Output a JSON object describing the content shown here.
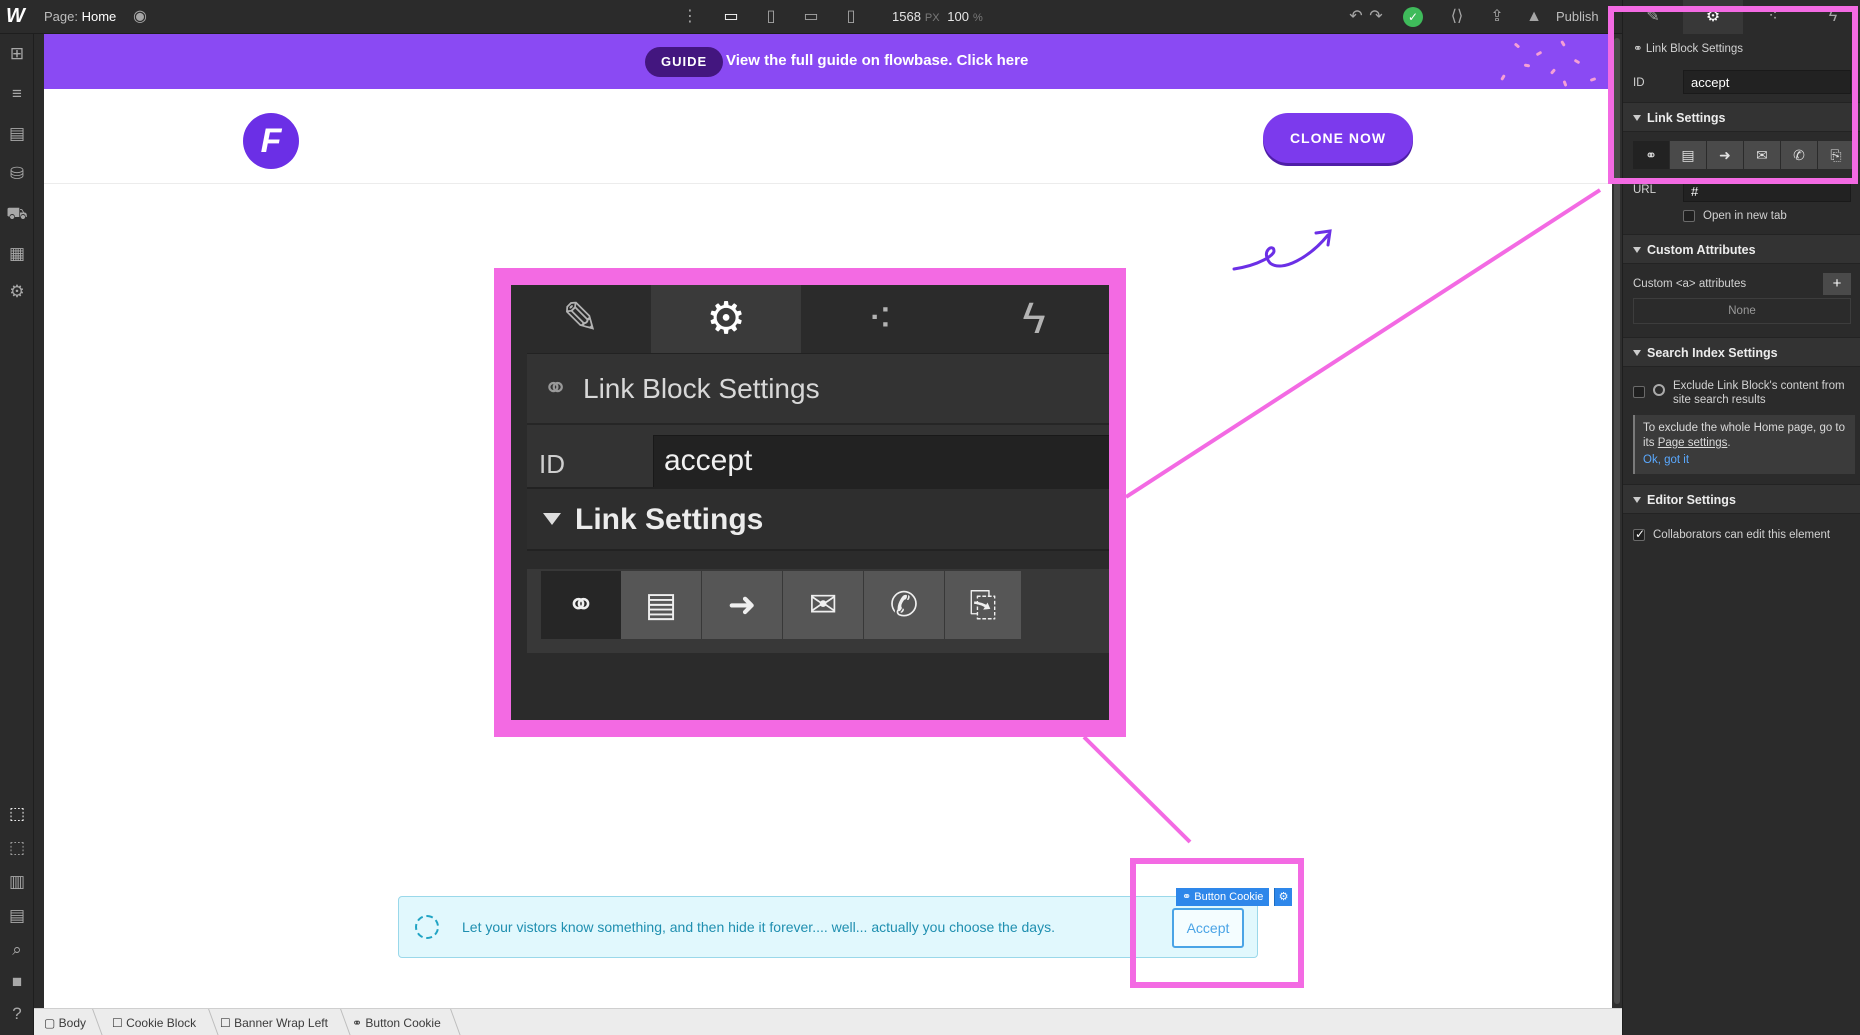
{
  "topbar": {
    "page_prefix": "Page:",
    "page_name": "Home",
    "canvas_width": "1568",
    "canvas_unit": "PX",
    "zoom": "100",
    "zoom_unit": "%",
    "publish_label": "Publish"
  },
  "canvas": {
    "banner": {
      "guide_label": "GUIDE",
      "text": "View the full guide on flowbase. Click here",
      "color": "#8a4af3"
    },
    "nav": {
      "logo_letter": "F",
      "cta_label": "CLONE NOW"
    },
    "cookie": {
      "text": "Let your vistors know something, and then hide it forever.... well... actually you choose the days.",
      "accept_label": "Accept",
      "selection_tag": "Button Cookie"
    }
  },
  "breadcrumb": [
    "Body",
    "Cookie Block",
    "Banner Wrap Left",
    "Button Cookie"
  ],
  "panel": {
    "tabs": [
      "style-brush-icon",
      "settings-gear-icon",
      "interactions-drops-icon",
      "lightning-icon"
    ],
    "header": "Link Block Settings",
    "id_label": "ID",
    "id_value": "accept",
    "link_settings": "Link Settings",
    "link_types": [
      "link-icon",
      "page-icon",
      "section-icon",
      "email-icon",
      "phone-icon",
      "attachment-icon"
    ],
    "url_label": "URL",
    "url_value": "#",
    "open_new_tab": "Open in new tab",
    "custom_attributes": "Custom Attributes",
    "custom_attr_label": "Custom <a> attributes",
    "custom_attr_empty": "None",
    "search_index": "Search Index Settings",
    "exclude_label": "Exclude Link Block's content from site search results",
    "hint_text": "To exclude the whole Home page, go to its",
    "hint_link": "Page settings",
    "hint_ok": "Ok, got it",
    "editor_settings": "Editor Settings",
    "collab_label": "Collaborators can edit this element"
  },
  "zoom": {
    "header": "Link Block Settings",
    "id_label": "ID",
    "id_value": "accept",
    "link_settings": "Link Settings"
  },
  "colors": {
    "highlight": "#f36ae3",
    "brand": "#7c3aed",
    "selection": "#2e87ea"
  }
}
